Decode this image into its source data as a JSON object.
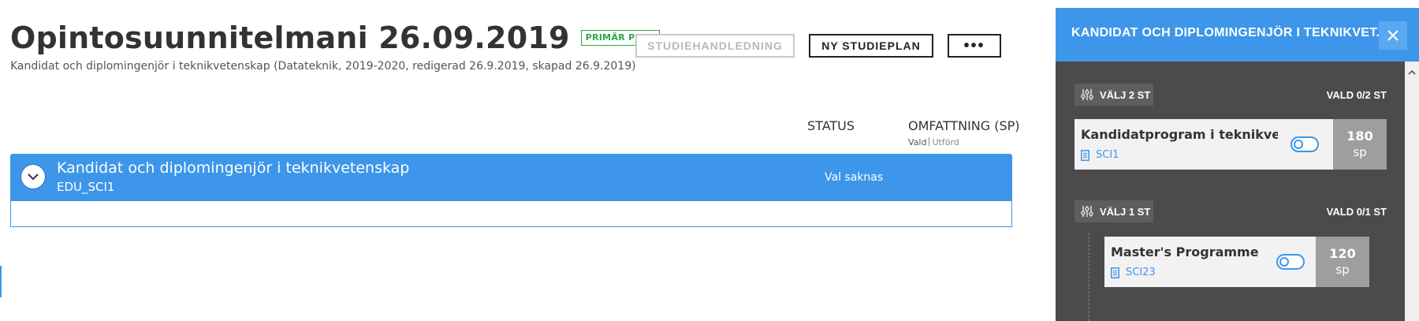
{
  "header": {
    "title": "Opintosuunnitelmani 26.09.2019",
    "badge": "PRIMÄR PLAN",
    "subtitle": "Kandidat och diplomingenjör i teknikvetenskap (Datateknik, 2019-2020, redigerad 26.9.2019, skapad 26.9.2019)",
    "dropdown_icon": "chevron-down-icon"
  },
  "toolbar": {
    "guide_label": "STUDIEHANDLEDNING",
    "new_plan_label": "NY STUDIEPLAN",
    "more_label": "•••"
  },
  "columns": {
    "status": "STATUS",
    "scope": "OMFATTNING (SP)",
    "selected": "Vald",
    "completed": "Utförd"
  },
  "degree": {
    "name": "Kandidat och diplomingenjör i teknikvetenskap",
    "code": "EDU_SCI1",
    "status": "Val saknas",
    "expand_icon": "chevron-down-icon"
  },
  "panel": {
    "title": "KANDIDAT OCH DIPLOMINGENJÖR I TEKNIKVET...",
    "close_icon": "close-icon",
    "groups": [
      {
        "label": "VÄLJ 2 ST",
        "count": "VALD 0/2 ST",
        "icon": "sliders-icon",
        "programme": {
          "name": "Kandidatprogram i teknikvetenskap",
          "code": "SCI1",
          "credits": "180",
          "unit": "sp",
          "selected": false
        }
      },
      {
        "label": "VÄLJ 1 ST",
        "count": "VALD 0/1 ST",
        "icon": "sliders-icon",
        "programme": {
          "name": "Master's Programme in Life Science",
          "code": "SCI23",
          "credits": "120",
          "unit": "sp",
          "selected": false
        }
      }
    ]
  },
  "colors": {
    "accent": "#3d96ea",
    "panel_bg": "#4b4b4b",
    "badge_green": "#2aa84a",
    "credits_bg": "#9e9e9e"
  }
}
